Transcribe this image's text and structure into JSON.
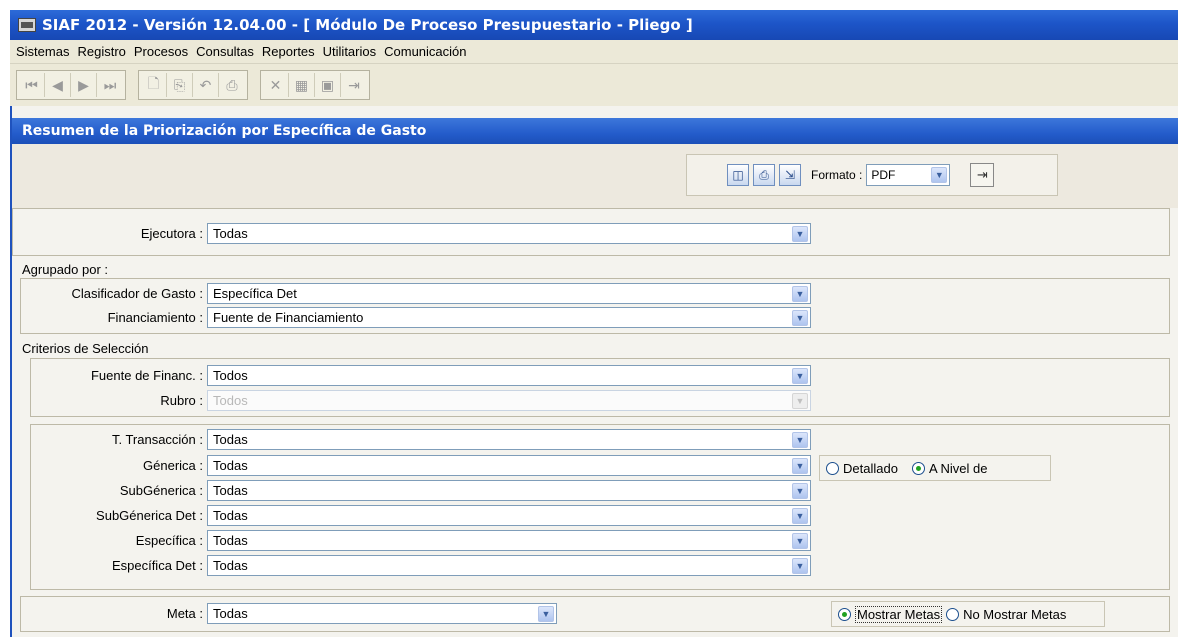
{
  "window": {
    "title": "SIAF 2012 - Versión 12.04.00 - [ Módulo De Proceso Presupuestario - Pliego ]"
  },
  "menu": [
    "Sistemas",
    "Registro",
    "Procesos",
    "Consultas",
    "Reportes",
    "Utilitarios",
    "Comunicación"
  ],
  "toolbar": {
    "nav_icons": [
      "first-record-icon",
      "previous-record-icon",
      "next-record-icon",
      "last-record-icon"
    ],
    "edit_icons": [
      "new-icon",
      "copy-icon",
      "undo-icon",
      "print-icon"
    ],
    "action_icons": [
      "delete-icon",
      "grid-icon",
      "save-icon",
      "exit-icon"
    ]
  },
  "form": {
    "title": "Resumen de la Priorización por Específica de Gasto",
    "format_label": "Formato :",
    "format_value": "PDF",
    "ejecutora": {
      "label": "Ejecutora :",
      "value": "Todas"
    },
    "agrupado_title": "Agrupado por :",
    "clasificador": {
      "label": "Clasificador de Gasto :",
      "value": "Específica Det"
    },
    "financiamiento": {
      "label": "Financiamiento :",
      "value": "Fuente de Financiamiento"
    },
    "criterios_title": "Criterios de Selección",
    "fuente": {
      "label": "Fuente de Financ. :",
      "value": "Todos"
    },
    "rubro": {
      "label": "Rubro :",
      "value": "Todos"
    },
    "transaccion": {
      "label": "T. Transacción :",
      "value": "Todas"
    },
    "generica": {
      "label": "Génerica :",
      "value": "Todas"
    },
    "subgenerica": {
      "label": "SubGénerica :",
      "value": "Todas"
    },
    "subgenerica_det": {
      "label": "SubGénerica Det :",
      "value": "Todas"
    },
    "especifica": {
      "label": "Específica :",
      "value": "Todas"
    },
    "especifica_det": {
      "label": "Específica Det :",
      "value": "Todas"
    },
    "detail_options": {
      "detallado": "Detallado",
      "a_nivel": "A Nivel de",
      "selected": "a_nivel"
    },
    "meta": {
      "label": "Meta :",
      "value": "Todas"
    },
    "meta_options": {
      "mostrar": "Mostrar Metas",
      "no_mostrar": "No Mostrar Metas",
      "selected": "mostrar"
    }
  }
}
